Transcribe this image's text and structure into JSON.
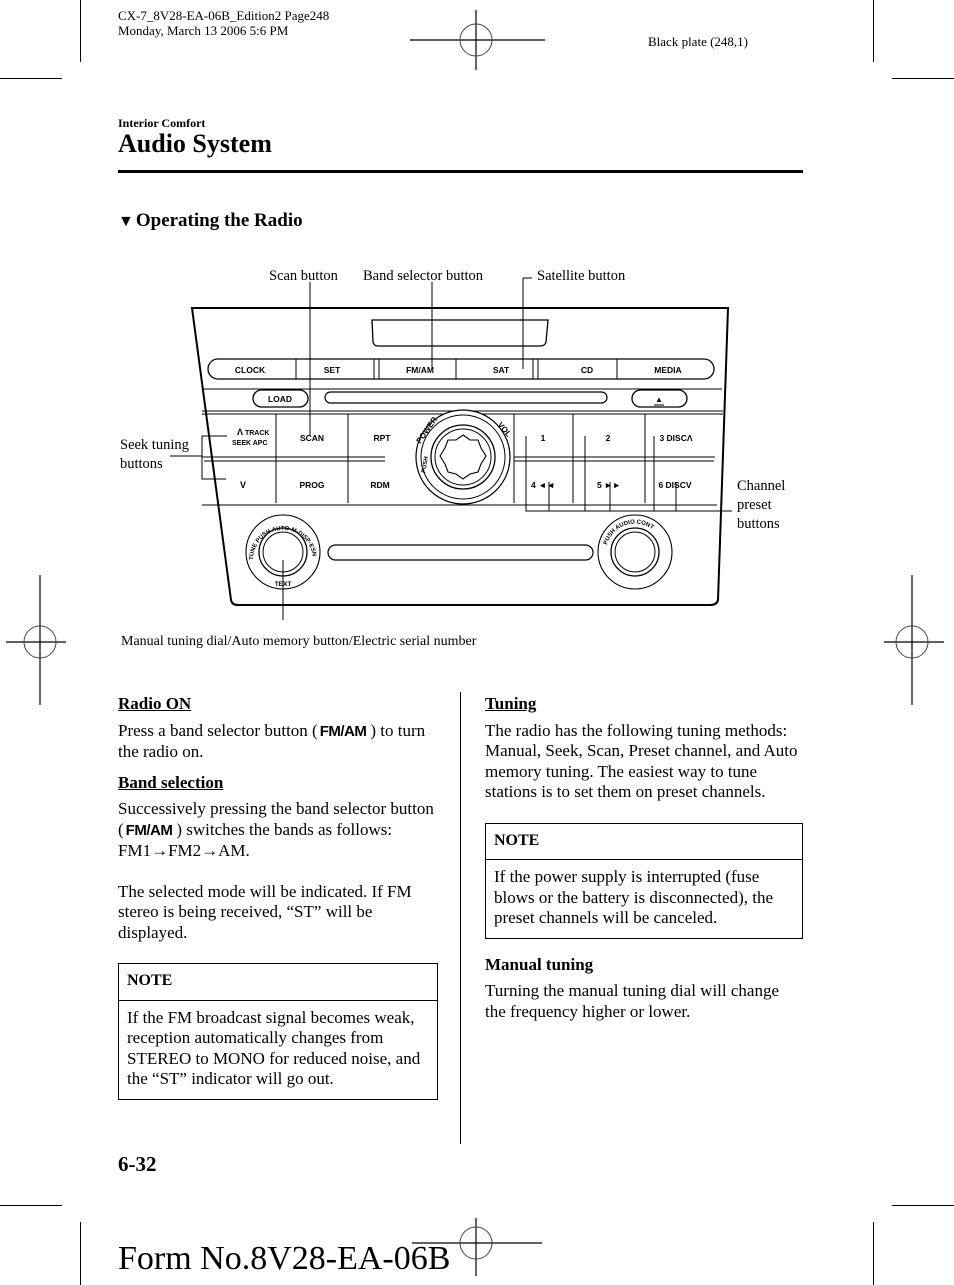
{
  "print_header": {
    "line1": "CX-7_8V28-EA-06B_Edition2 Page248",
    "line2": "Monday, March 13 2006 5:6 PM",
    "plate": "Black plate (248,1)"
  },
  "header": {
    "section": "Interior Comfort",
    "title": "Audio System"
  },
  "subheading": {
    "marker": "▼",
    "text": "Operating the Radio"
  },
  "diagram": {
    "callouts": {
      "scan": "Scan button",
      "band": "Band selector button",
      "sat": "Satellite button",
      "seek_l1": "Seek tuning",
      "seek_l2": "buttons",
      "preset_l1": "Channel",
      "preset_l2": "preset",
      "preset_l3": "buttons",
      "dial": "Manual tuning dial/Auto memory button/Electric serial number"
    },
    "top_buttons": [
      "CLOCK",
      "SET",
      "FM/AM",
      "SAT",
      "CD",
      "MEDIA"
    ],
    "load": "LOAD",
    "eject": "▲",
    "left_grid": {
      "seek_up_arrow": "Λ",
      "seek_up_l1": "TRACK",
      "seek_up_l2": "SEEK APC",
      "scan": "SCAN",
      "rpt": "RPT",
      "seek_down": "V",
      "prog": "PROG",
      "rdm": "RDM"
    },
    "presets": [
      "1",
      "2",
      "3 DISCΛ",
      "4 ◄◄",
      "5 ►►",
      "6 DISCV"
    ],
    "knob_labels": {
      "power": "POWER",
      "push": "PUSH",
      "vol": "VOL",
      "tune_ring": "TUNE PUSH AUTO-M·DISP·ESN",
      "text": "TEXT",
      "audio_ring": "PUSH AUDIO CONT"
    }
  },
  "left_column": {
    "radio_on_heading": "Radio ON",
    "radio_on_pre": "Press a band selector button (",
    "radio_on_btn": "FM/AM",
    "radio_on_post": ") to turn the radio on.",
    "band_heading": "Band selection",
    "band_pre": "Successively pressing the band selector button (",
    "band_btn": "FM/AM",
    "band_post": ") switches the bands as follows: FM1→FM2→AM.",
    "mode_text": "The selected mode will be indicated. If FM stereo is being received, “ST” will be displayed.",
    "note_head": "NOTE",
    "note_body": "If the FM broadcast signal becomes weak, reception automatically changes from STEREO to MONO for reduced noise, and the “ST” indicator will go out."
  },
  "right_column": {
    "tuning_heading": "Tuning",
    "tuning_text": "The radio has the following tuning methods: Manual, Seek, Scan, Preset channel, and Auto memory tuning. The easiest way to tune stations is to set them on preset channels.",
    "note_head": "NOTE",
    "note_body": "If the power supply is interrupted (fuse blows or the battery is disconnected), the preset channels will be canceled.",
    "manual_heading": "Manual tuning",
    "manual_text": "Turning the manual tuning dial will change the frequency higher or lower."
  },
  "footer": {
    "page_number": "6-32",
    "form_no": "Form No.8V28-EA-06B"
  }
}
